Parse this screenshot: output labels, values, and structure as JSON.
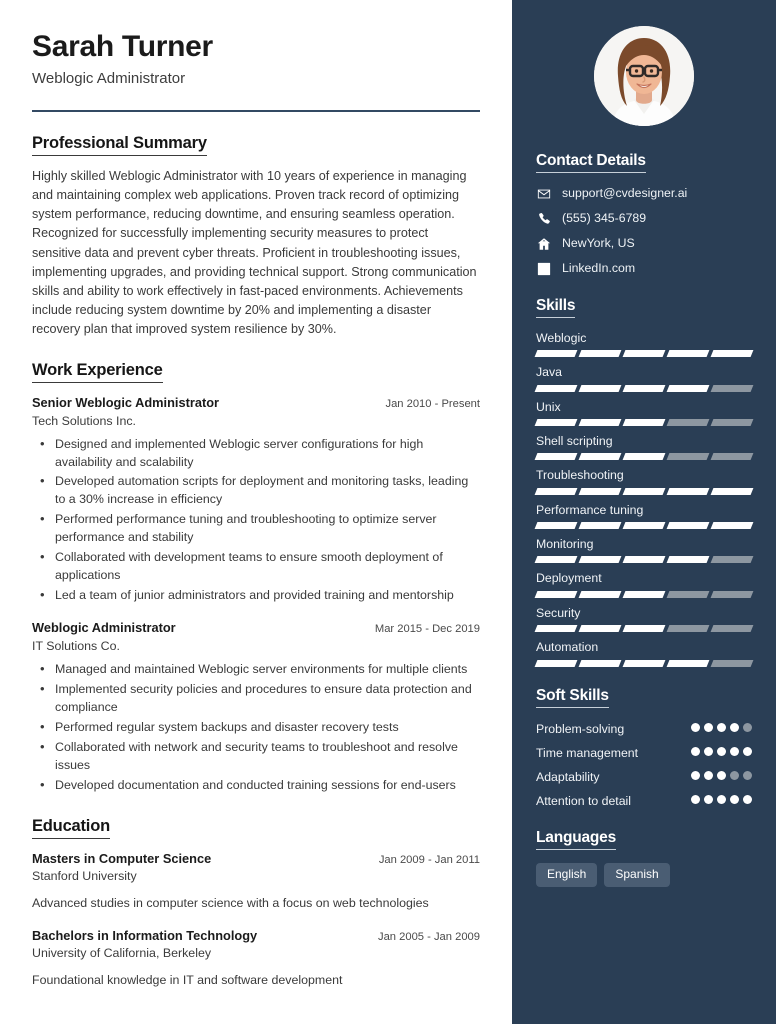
{
  "header": {
    "name": "Sarah Turner",
    "job_title": "Weblogic Administrator"
  },
  "sections": {
    "summary_heading": "Professional Summary",
    "summary_text": "Highly skilled Weblogic Administrator with 10 years of experience in managing and maintaining complex web applications. Proven track record of optimizing system performance, reducing downtime, and ensuring seamless operation. Recognized for successfully implementing security measures to protect sensitive data and prevent cyber threats. Proficient in troubleshooting issues, implementing upgrades, and providing technical support. Strong communication skills and ability to work effectively in fast-paced environments. Achievements include reducing system downtime by 20% and implementing a disaster recovery plan that improved system resilience by 30%.",
    "work_heading": "Work Experience",
    "education_heading": "Education"
  },
  "work": [
    {
      "role": "Senior Weblogic Administrator",
      "date": "Jan 2010 - Present",
      "org": "Tech Solutions Inc.",
      "bullets": [
        "Designed and implemented Weblogic server configurations for high availability and scalability",
        "Developed automation scripts for deployment and monitoring tasks, leading to a 30% increase in efficiency",
        "Performed performance tuning and troubleshooting to optimize server performance and stability",
        "Collaborated with development teams to ensure smooth deployment of applications",
        "Led a team of junior administrators and provided training and mentorship"
      ]
    },
    {
      "role": "Weblogic Administrator",
      "date": "Mar 2015 - Dec 2019",
      "org": "IT Solutions Co.",
      "bullets": [
        "Managed and maintained Weblogic server environments for multiple clients",
        "Implemented security policies and procedures to ensure data protection and compliance",
        "Performed regular system backups and disaster recovery tests",
        "Collaborated with network and security teams to troubleshoot and resolve issues",
        "Developed documentation and conducted training sessions for end-users"
      ]
    }
  ],
  "education": [
    {
      "degree": "Masters in Computer Science",
      "date": "Jan 2009 - Jan 2011",
      "school": "Stanford University",
      "description": "Advanced studies in computer science with a focus on web technologies"
    },
    {
      "degree": "Bachelors in Information Technology",
      "date": "Jan 2005 - Jan 2009",
      "school": "University of California, Berkeley",
      "description": "Foundational knowledge in IT and software development"
    }
  ],
  "sidebar": {
    "contact_heading": "Contact Details",
    "contact": [
      {
        "icon": "envelope-icon",
        "value": "support@cvdesigner.ai"
      },
      {
        "icon": "phone-icon",
        "value": "(555) 345-6789"
      },
      {
        "icon": "home-icon",
        "value": "NewYork, US"
      },
      {
        "icon": "linkedin-icon",
        "value": "LinkedIn.com"
      }
    ],
    "skills_heading": "Skills",
    "skills": [
      {
        "name": "Weblogic",
        "level": 5,
        "max": 5
      },
      {
        "name": "Java",
        "level": 4,
        "max": 5
      },
      {
        "name": "Unix",
        "level": 3,
        "max": 5
      },
      {
        "name": "Shell scripting",
        "level": 3,
        "max": 5
      },
      {
        "name": "Troubleshooting",
        "level": 5,
        "max": 5
      },
      {
        "name": "Performance tuning",
        "level": 5,
        "max": 5
      },
      {
        "name": "Monitoring",
        "level": 4,
        "max": 5
      },
      {
        "name": "Deployment",
        "level": 3,
        "max": 5
      },
      {
        "name": "Security",
        "level": 3,
        "max": 5
      },
      {
        "name": "Automation",
        "level": 4,
        "max": 5
      }
    ],
    "soft_skills_heading": "Soft Skills",
    "soft_skills": [
      {
        "name": "Problem-solving",
        "level": 4,
        "max": 5
      },
      {
        "name": "Time management",
        "level": 5,
        "max": 5
      },
      {
        "name": "Adaptability",
        "level": 3,
        "max": 5
      },
      {
        "name": "Attention to detail",
        "level": 5,
        "max": 5
      }
    ],
    "languages_heading": "Languages",
    "languages": [
      "English",
      "Spanish"
    ]
  },
  "colors": {
    "sidebar_bg": "#2a3e55",
    "rule": "#334a63",
    "bar_on": "#ffffff",
    "bar_off": "#8d97a1",
    "pill_bg": "#4a5d73"
  }
}
